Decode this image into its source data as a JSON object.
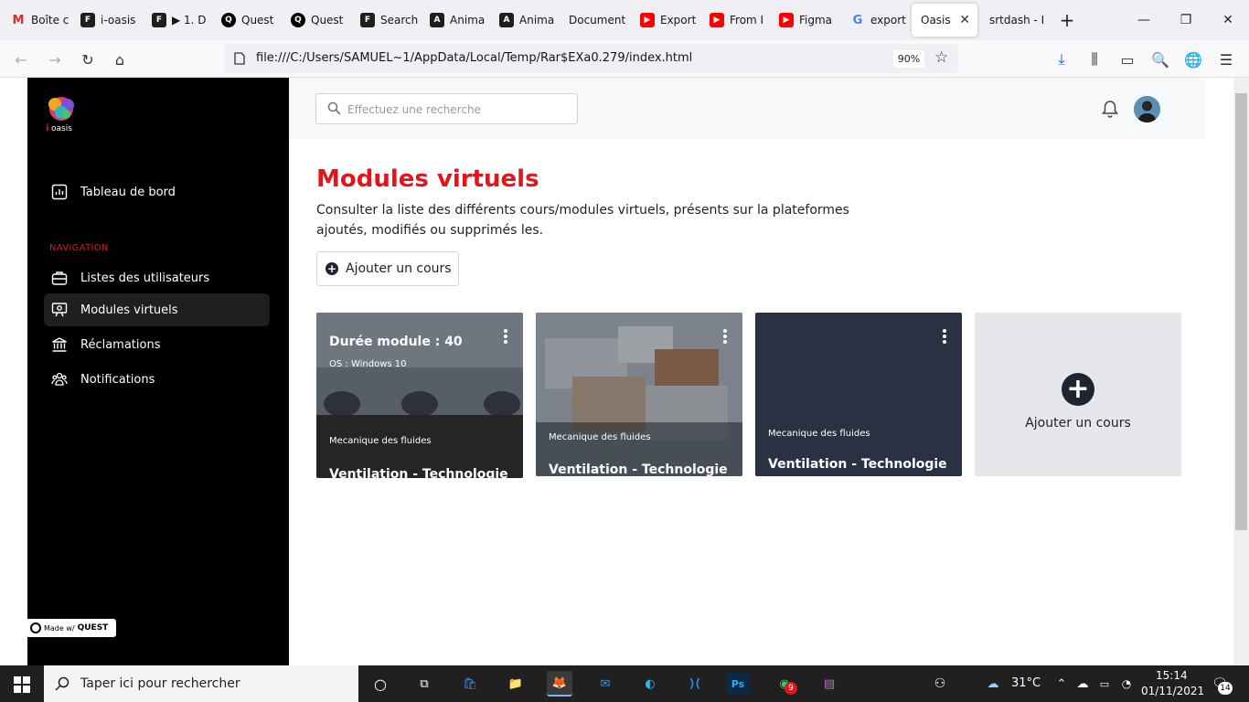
{
  "browser": {
    "tabs": [
      {
        "label": "Boîte c",
        "favicon": "gmail-icon",
        "color": "#d93025"
      },
      {
        "label": "i-oasis",
        "favicon": "figma-icon",
        "color": "#1e1e1e"
      },
      {
        "label": "▶ 1. D",
        "favicon": "figma-icon",
        "color": "#1e1e1e"
      },
      {
        "label": "Quest",
        "favicon": "quest-icon",
        "color": "#000000"
      },
      {
        "label": "Quest",
        "favicon": "quest-icon",
        "color": "#000000"
      },
      {
        "label": "Search",
        "favicon": "figma-icon",
        "color": "#1e1e1e"
      },
      {
        "label": "Anima",
        "favicon": "anima-icon",
        "color": "#1e1e1e"
      },
      {
        "label": "Anima",
        "favicon": "figma-icon",
        "color": "#1e1e1e"
      },
      {
        "label": "Document",
        "favicon": "",
        "color": ""
      },
      {
        "label": "Export",
        "favicon": "youtube-icon",
        "color": "#ff0000"
      },
      {
        "label": "From I",
        "favicon": "youtube-icon",
        "color": "#ff0000"
      },
      {
        "label": "Figma",
        "favicon": "youtube-icon",
        "color": "#ff0000"
      },
      {
        "label": "export",
        "favicon": "google-icon",
        "color": "#4285f4"
      },
      {
        "label": "Oasis",
        "favicon": "",
        "color": ""
      },
      {
        "label": "srtdash - IC",
        "favicon": "",
        "color": ""
      }
    ],
    "new_tab": "+",
    "url": "file:///C:/Users/SAMUEL~1/AppData/Local/Temp/Rar$EXa0.279/index.html",
    "zoom": "90%"
  },
  "sidebar": {
    "logo_text": "i oasis",
    "dashboard": "Tableau de bord",
    "nav_heading": "NAVIGATION",
    "items": [
      {
        "label": "Listes des utilisateurs",
        "icon": "briefcase-icon"
      },
      {
        "label": "Modules virtuels",
        "icon": "projector-icon"
      },
      {
        "label": "Réclamations",
        "icon": "bank-icon"
      },
      {
        "label": "Notifications",
        "icon": "users-icon"
      }
    ],
    "made_with": "Made w/",
    "made_with_brand": "QUEST"
  },
  "topbar": {
    "search_placeholder": "Effectuez une recherche"
  },
  "main": {
    "title": "Modules virtuels",
    "description": "Consulter la liste des différents cours/modules virtuels, présents sur la plateformes ajoutés, modifiés ou supprimés les.",
    "add_button": "Ajouter un cours",
    "cards": [
      {
        "overlay_title": "Durée module : 40",
        "overlay_sub": "OS : Windows 10",
        "category": "Mecanique des fluides",
        "name": "Ventilation - Technologie"
      },
      {
        "category": "Mecanique des fluides",
        "name": "Ventilation - Technologie"
      },
      {
        "category": "Mecanique des fluides",
        "name": "Ventilation - Technologie"
      }
    ],
    "add_card_label": "Ajouter un cours"
  },
  "taskbar": {
    "search_placeholder": "Taper ici pour rechercher",
    "weather": "31°C",
    "time": "15:14",
    "date": "01/11/2021",
    "whatsapp_badge": "9",
    "notif_count": "14"
  },
  "colors": {
    "accent_red": "#e3151a",
    "sidebar_bg": "#000000",
    "card_dark": "#2a3142"
  }
}
